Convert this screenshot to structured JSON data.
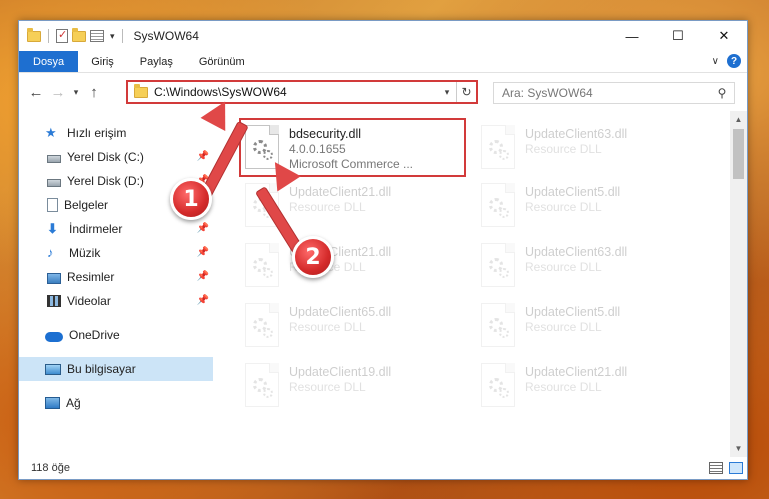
{
  "window": {
    "title": "SysWOW64",
    "controls": {
      "minimize": "—",
      "maximize": "☐",
      "close": "✕"
    }
  },
  "ribbon": {
    "tabs": [
      "Dosya",
      "Giriş",
      "Paylaş",
      "Görünüm"
    ],
    "help": "?",
    "accent": "#1e6fd0"
  },
  "navbar": {
    "address": "C:\\Windows\\SysWOW64",
    "search_placeholder": "Ara: SysWOW64"
  },
  "sidebar": {
    "quick_access": "Hızlı erişim",
    "items": [
      {
        "label": "Yerel Disk (C:)",
        "icon": "drive-icon",
        "pinned": true
      },
      {
        "label": "Yerel Disk (D:)",
        "icon": "drive-icon",
        "pinned": true
      },
      {
        "label": "Belgeler",
        "icon": "documents-icon",
        "pinned": true
      },
      {
        "label": "İndirmeler",
        "icon": "downloads-icon",
        "pinned": true
      },
      {
        "label": "Müzik",
        "icon": "music-icon",
        "pinned": true
      },
      {
        "label": "Resimler",
        "icon": "pictures-icon",
        "pinned": true
      },
      {
        "label": "Videolar",
        "icon": "videos-icon",
        "pinned": true
      }
    ],
    "onedrive": "OneDrive",
    "this_pc": "Bu bilgisayar",
    "network": "Ağ"
  },
  "files": {
    "highlighted": {
      "name": "bdsecurity.dll",
      "version": "4.0.0.1655",
      "desc": "Microsoft Commerce ..."
    },
    "col1": [
      {
        "name": "UpdateClient21.dll",
        "desc": "Resource DLL"
      },
      {
        "name": "UpdateClient21.dll",
        "desc": "Resource DLL"
      },
      {
        "name": "UpdateClient65.dll",
        "desc": "Resource DLL"
      },
      {
        "name": "UpdateClient19.dll",
        "desc": "Resource DLL"
      }
    ],
    "col2": [
      {
        "name": "UpdateClient63.dll",
        "desc": "Resource DLL"
      },
      {
        "name": "UpdateClient5.dll",
        "desc": "Resource DLL"
      },
      {
        "name": "UpdateClient63.dll",
        "desc": "Resource DLL"
      },
      {
        "name": "UpdateClient5.dll",
        "desc": "Resource DLL"
      },
      {
        "name": "UpdateClient21.dll",
        "desc": "Resource DLL"
      }
    ]
  },
  "status": {
    "count": "118 öğe"
  },
  "annotations": {
    "step1": "1",
    "step2": "2",
    "color": "#d23a3a"
  }
}
